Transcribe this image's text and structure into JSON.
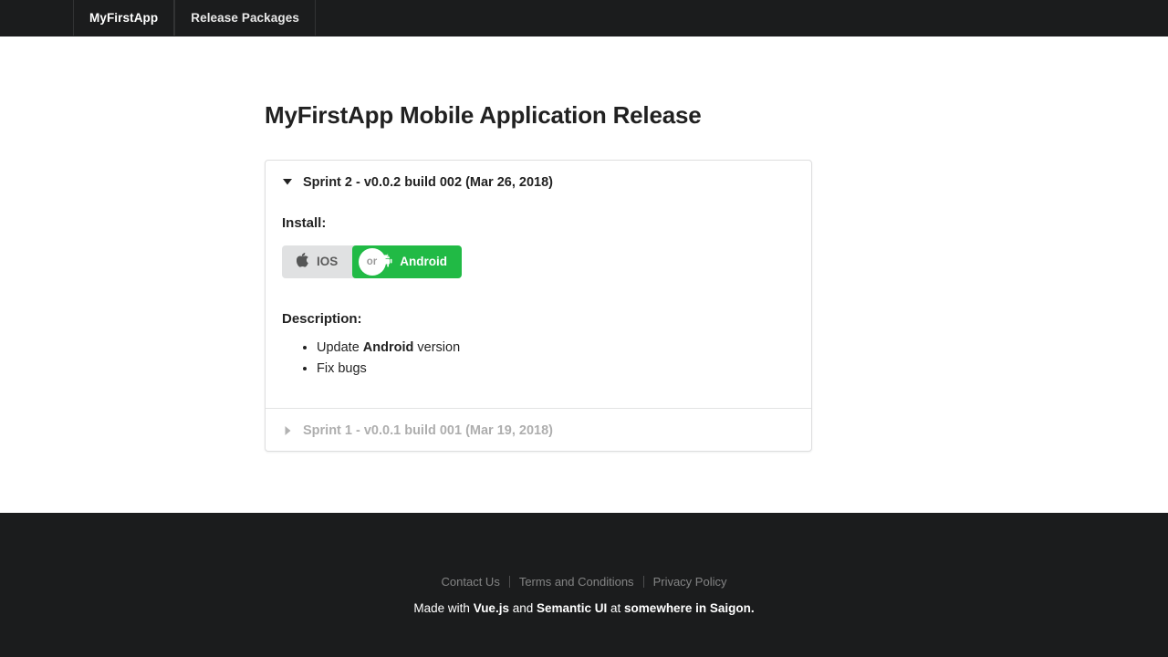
{
  "topbar": {
    "items": [
      {
        "label": "MyFirstApp",
        "name": "nav-item-myfirstapp",
        "active": true
      },
      {
        "label": "Release Packages",
        "name": "nav-item-release-packages",
        "active": false
      }
    ]
  },
  "main": {
    "title": "MyFirstApp Mobile Application Release",
    "accordion": {
      "sections": [
        {
          "title": "Sprint 2 - v0.0.2 build 002 (Mar 26, 2018)",
          "expanded": true,
          "caret_icon": "caret-down-icon",
          "install_label": "Install:",
          "buttons": {
            "ios": {
              "label": "IOS",
              "icon": "apple-icon",
              "color": "#e0e1e2"
            },
            "or": {
              "label": "or"
            },
            "android": {
              "label": "Android",
              "icon": "android-icon",
              "color": "#21ba45"
            }
          },
          "description_label": "Description:",
          "description_items": [
            {
              "pre": "Update ",
              "strong": "Android",
              "post": " version"
            },
            {
              "pre": "Fix bugs",
              "strong": "",
              "post": ""
            }
          ]
        },
        {
          "title": "Sprint 1 - v0.0.1 build 001 (Mar 19, 2018)",
          "expanded": false,
          "caret_icon": "caret-right-icon"
        }
      ]
    }
  },
  "footer": {
    "links": [
      {
        "label": "Contact Us",
        "name": "footer-link-contact-us"
      },
      {
        "label": "Terms and Conditions",
        "name": "footer-link-terms-and-conditions"
      },
      {
        "label": "Privacy Policy",
        "name": "footer-link-privacy-policy"
      }
    ],
    "made_with": {
      "prefix": "Made with ",
      "tech1": "Vue.js",
      "mid": " and ",
      "tech2": "Semantic UI",
      "mid2": " at ",
      "place": "somewhere in Saigon."
    }
  },
  "colors": {
    "dark": "#1b1c1d",
    "green": "#21ba45",
    "grey_button": "#e0e1e2",
    "border": "rgba(34,36,38,0.15)"
  }
}
